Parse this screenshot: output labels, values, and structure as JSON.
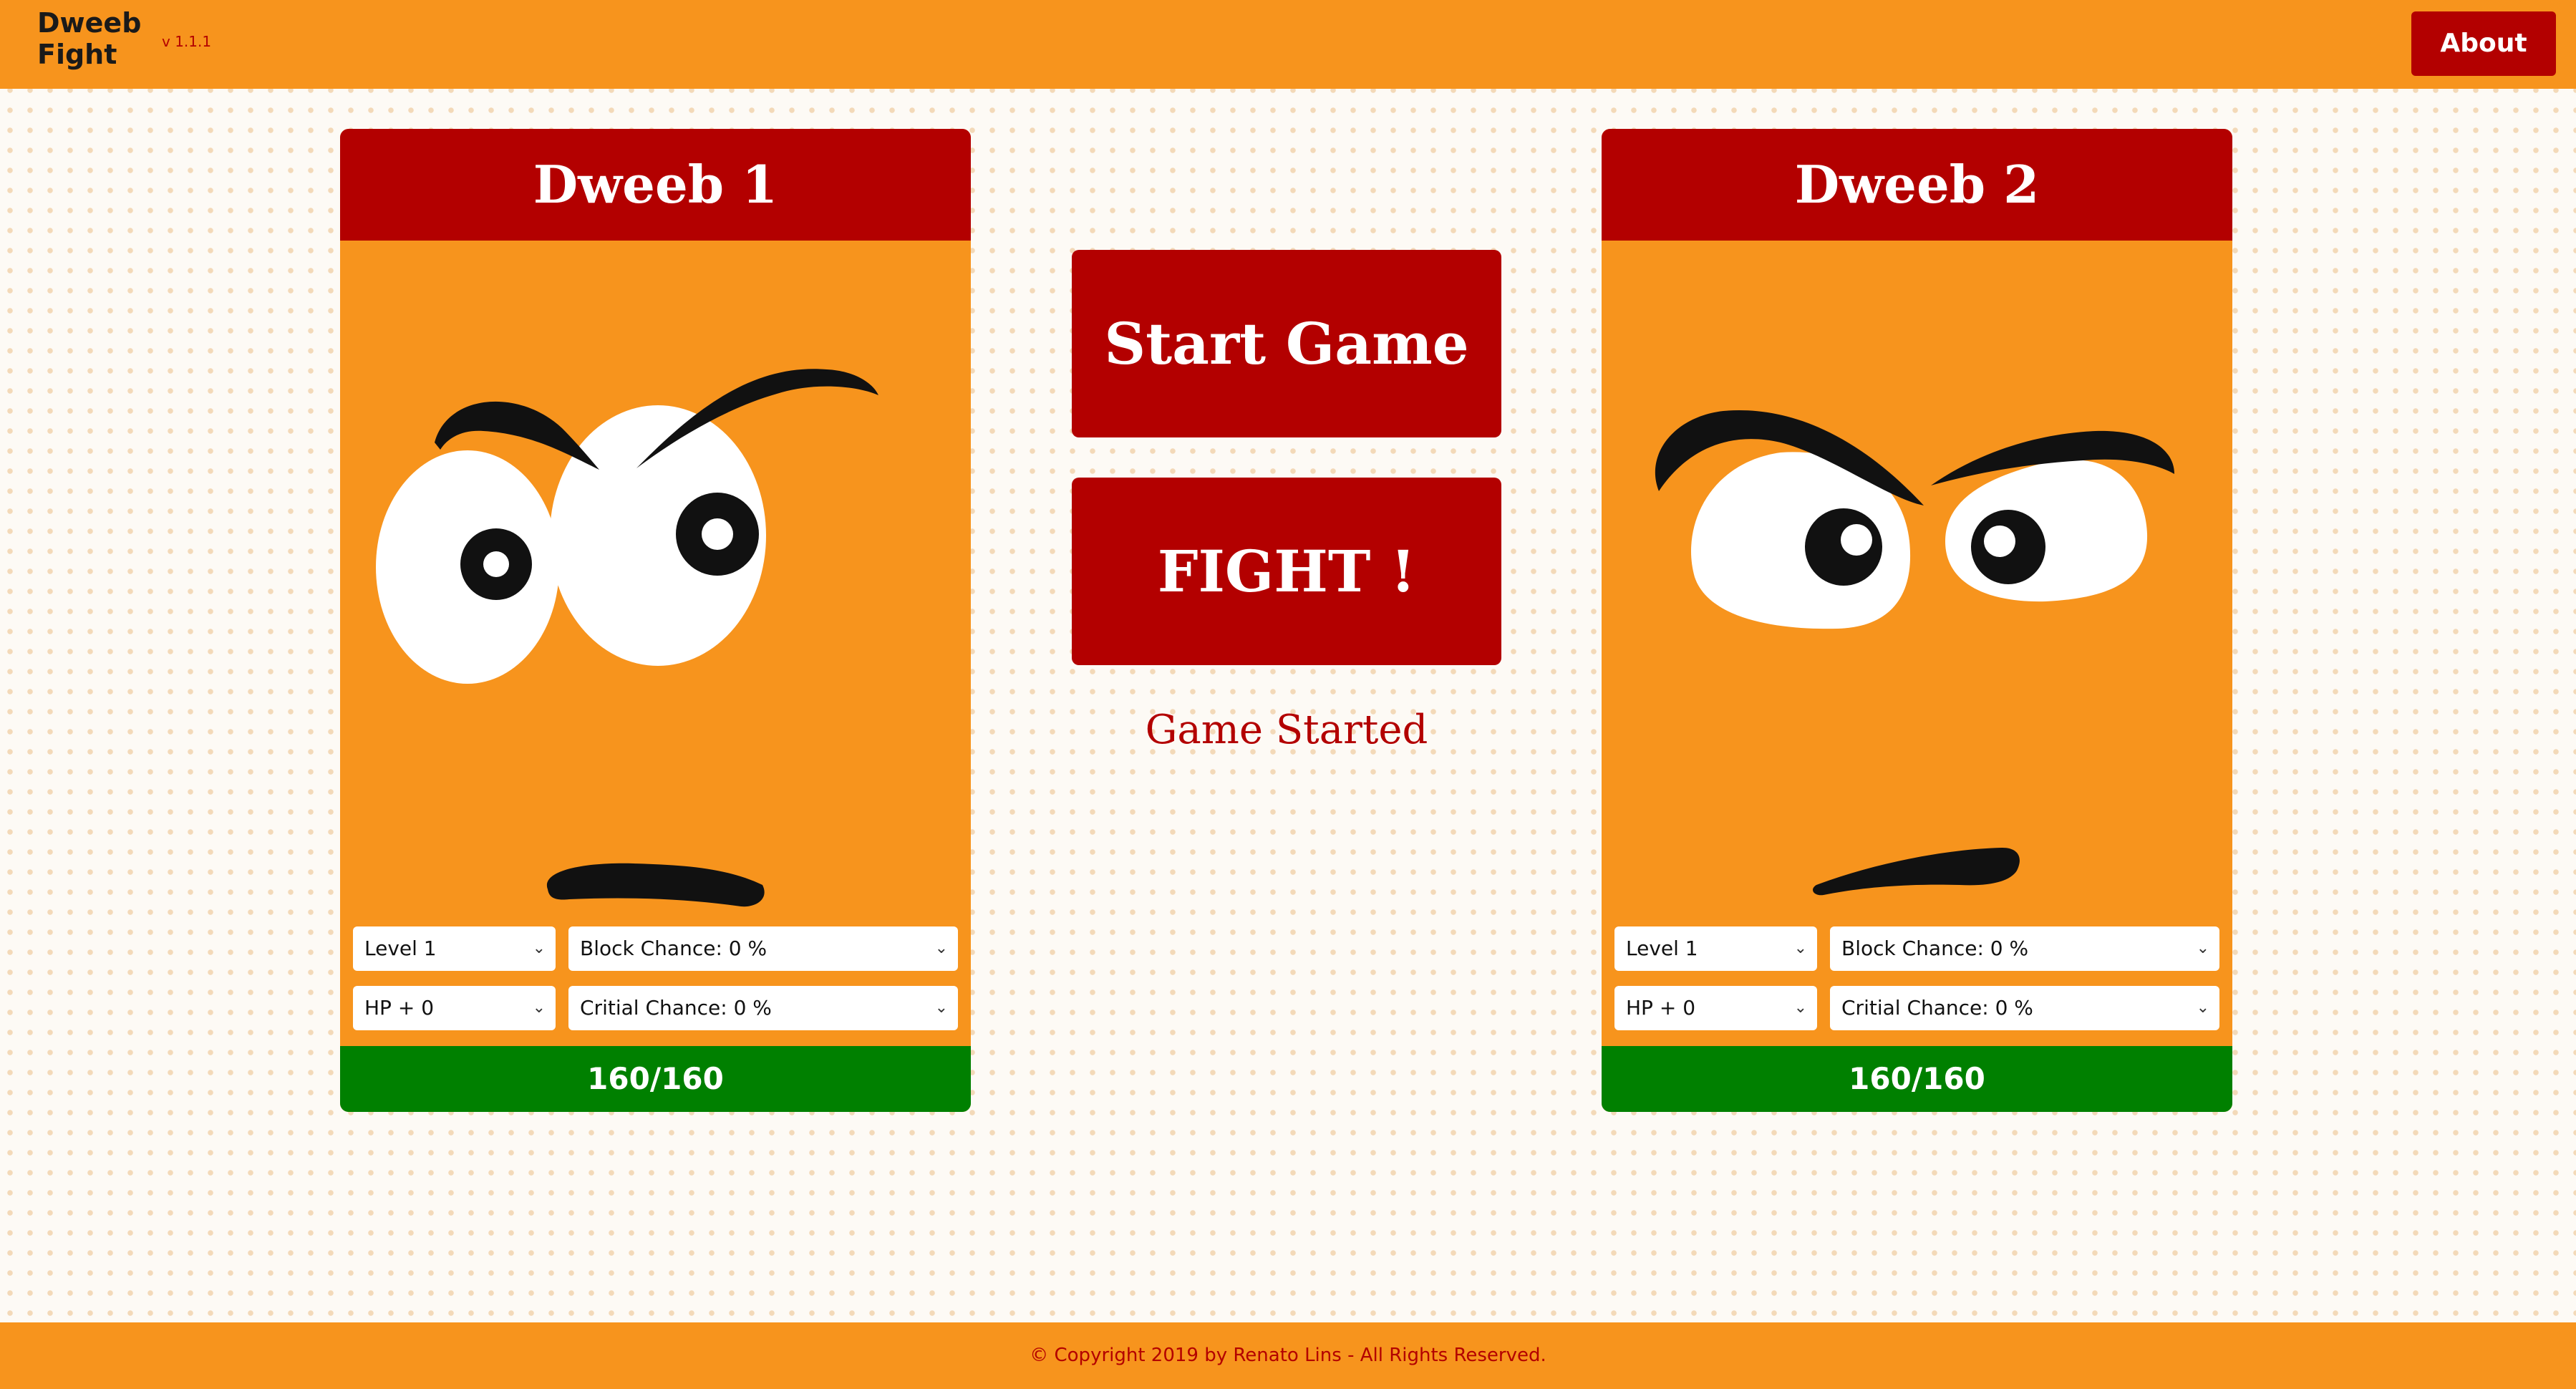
{
  "header": {
    "logo_text": "Dweeb Fight",
    "version": "v 1.1.1",
    "about_label": "About"
  },
  "players": [
    {
      "title": "Dweeb 1",
      "level": "Level 1",
      "block": "Block Chance: 0 %",
      "hp_bonus": "HP + 0",
      "crit": "Critial Chance: 0 %",
      "hp": "160/160"
    },
    {
      "title": "Dweeb 2",
      "level": "Level 1",
      "block": "Block Chance: 0 %",
      "hp_bonus": "HP + 0",
      "crit": "Critial Chance: 0 %",
      "hp": "160/160"
    }
  ],
  "controls": {
    "start_label": "Start Game",
    "fight_label": "FIGHT !",
    "status": "Game Started"
  },
  "footer": {
    "copyright": "© Copyright 2019 by Renato Lins - All Rights Reserved."
  },
  "colors": {
    "orange": "#f7941d",
    "red": "#b30000",
    "green": "#008000"
  },
  "icons": {
    "select_arrow": "chevron-down-icon"
  }
}
